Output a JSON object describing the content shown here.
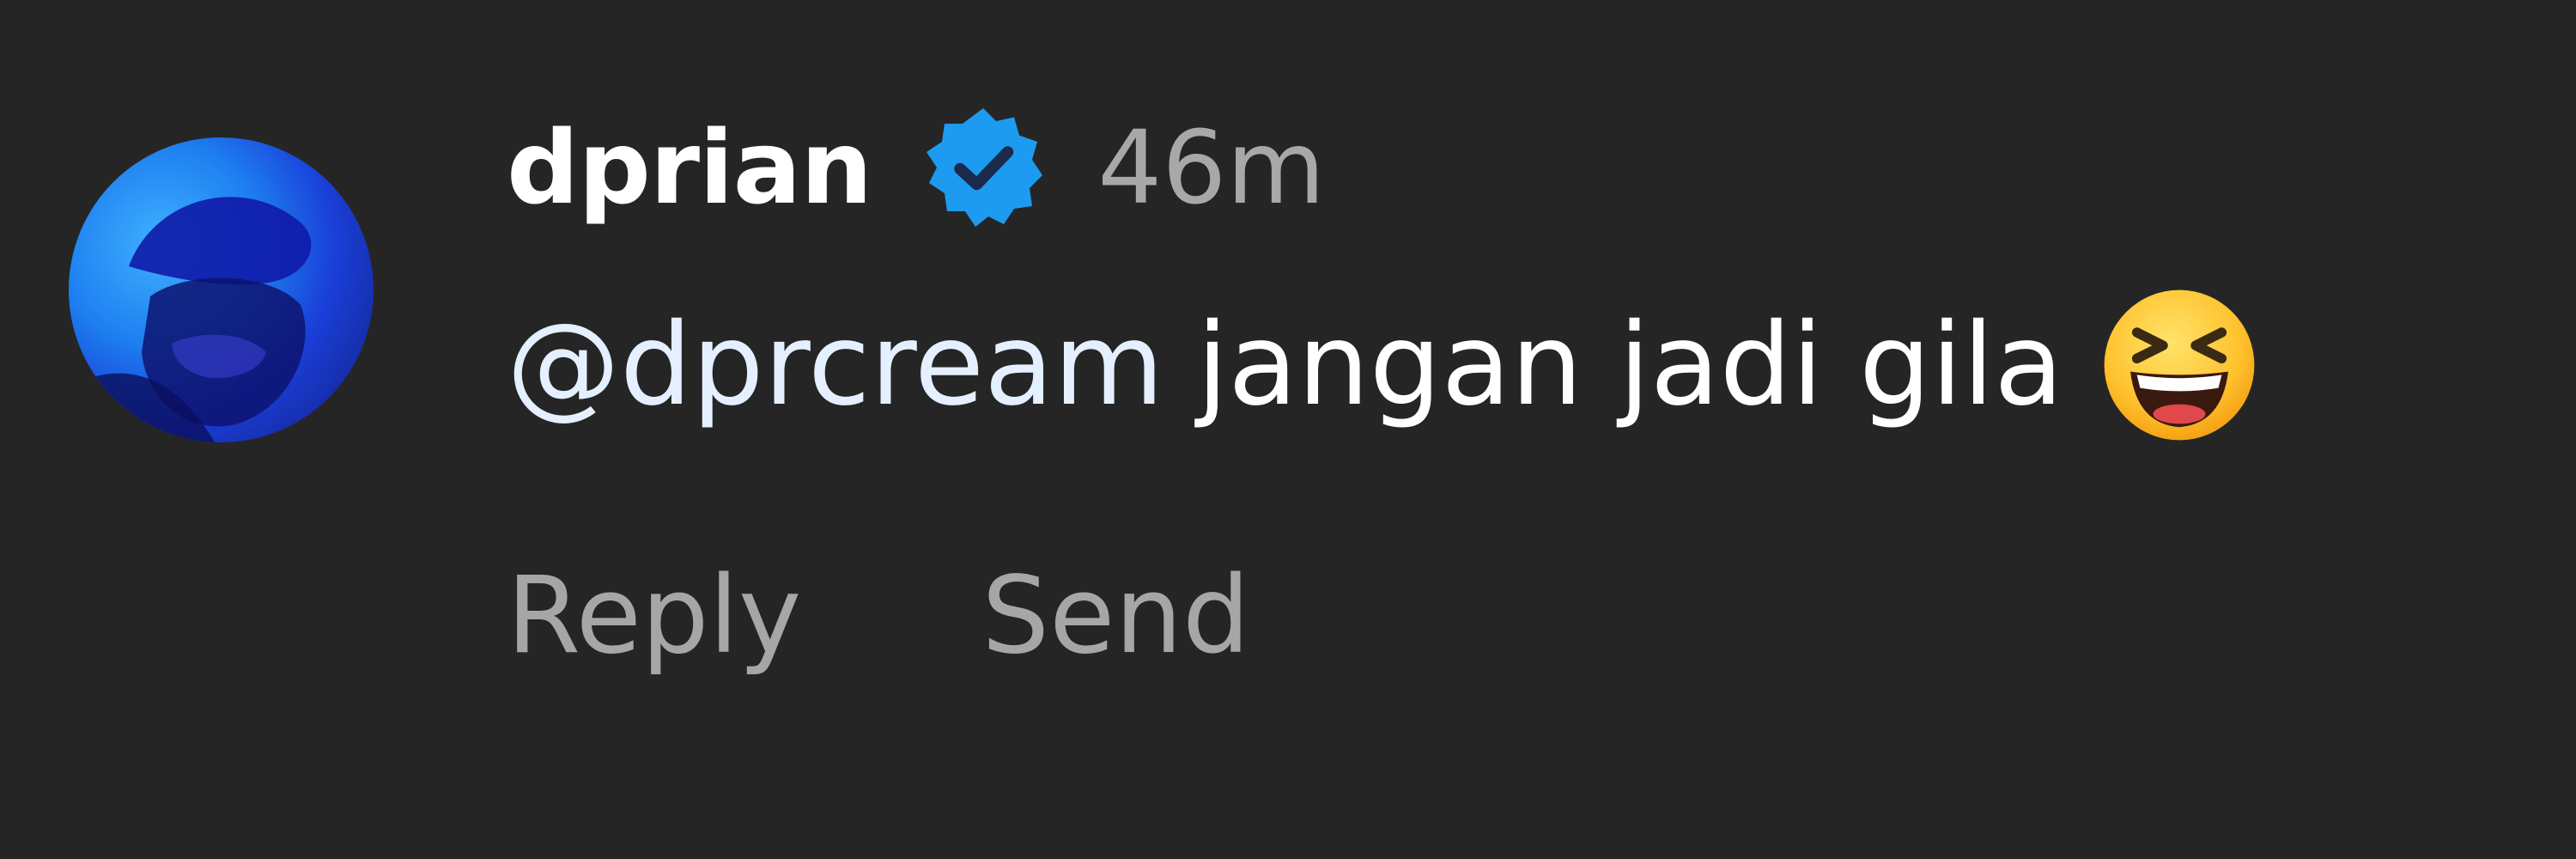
{
  "comment": {
    "username": "dprian",
    "verified_icon": "verified-badge-icon",
    "timestamp": "46m",
    "mention": "@dprcream",
    "text": "jangan jadi gila",
    "emoji": "grinning-squinting-face-emoji",
    "actions": {
      "reply": "Reply",
      "send": "Send"
    }
  },
  "colors": {
    "background": "#252525",
    "username": "#ffffff",
    "timestamp": "#a8a8a8",
    "mention": "#e4f0ff",
    "badge": "#1d9bf0",
    "action": "#a6a6a6"
  }
}
